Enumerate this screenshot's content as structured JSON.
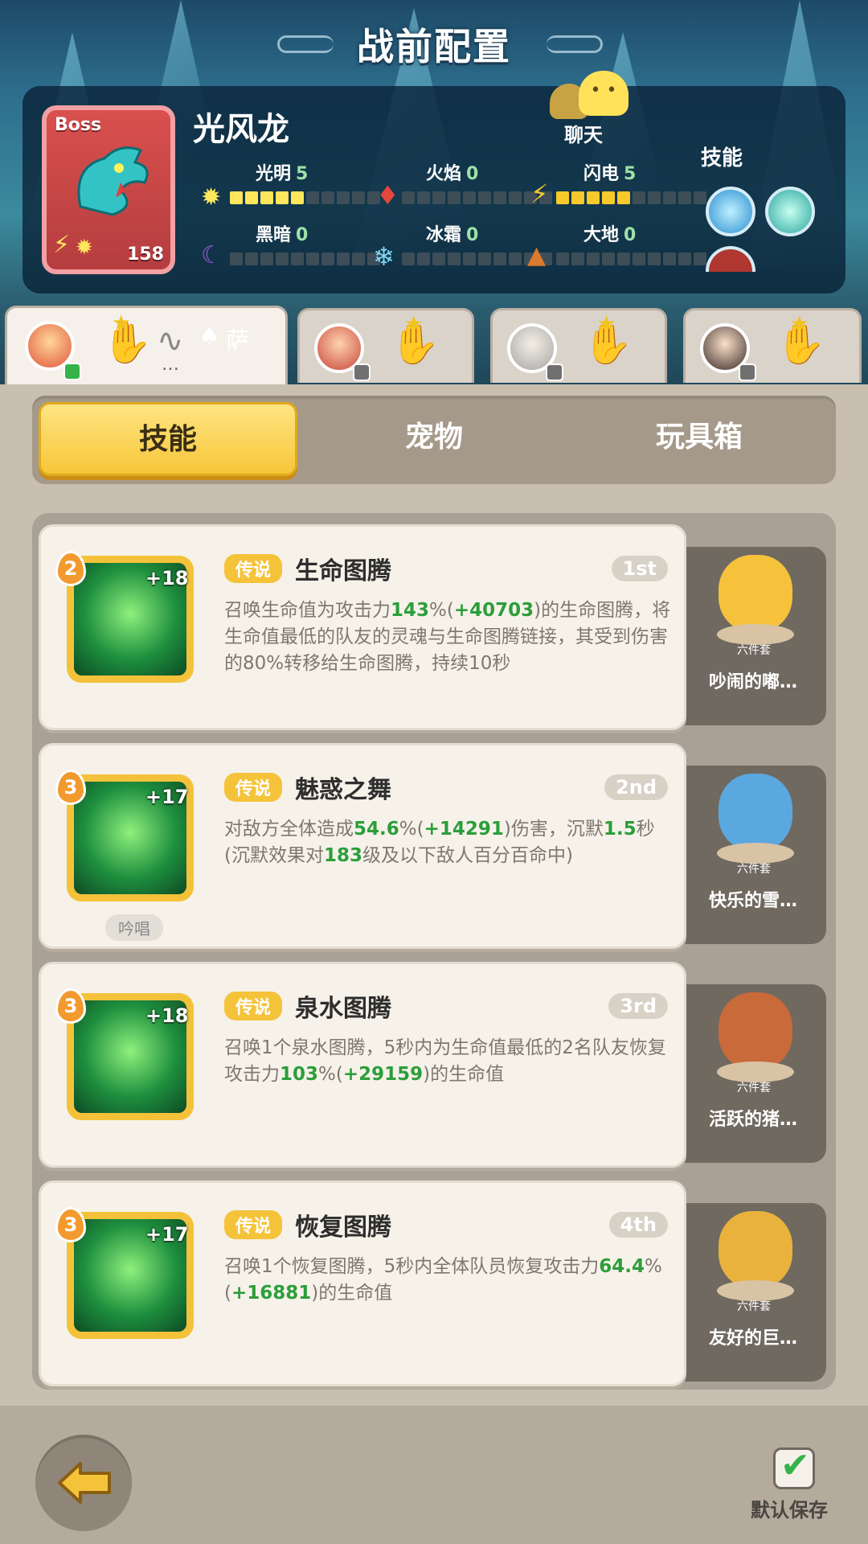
{
  "header": {
    "title": "战前配置"
  },
  "boss": {
    "tag": "Boss",
    "name": "光风龙",
    "level": "158",
    "elements": [
      {
        "label": "光明",
        "value": "5",
        "level": 5,
        "color": "#ffe65c"
      },
      {
        "label": "火焰",
        "value": "0",
        "level": 0,
        "color": "#e2483b"
      },
      {
        "label": "闪电",
        "value": "5",
        "level": 5,
        "color": "#f7c92a"
      },
      {
        "label": "黑暗",
        "value": "0",
        "level": 0,
        "color": "#9b5ad8"
      },
      {
        "label": "冰霜",
        "value": "0",
        "level": 0,
        "color": "#7fd6f2"
      },
      {
        "label": "大地",
        "value": "0",
        "level": 0,
        "color": "#d97a2c"
      }
    ],
    "chat_label": "聊天",
    "skills_label": "技能",
    "skill_icons": [
      "ice-burst-icon",
      "tornado-icon",
      "fire-icon"
    ]
  },
  "team_tabs": [
    {
      "player": "萨",
      "active": true
    },
    {
      "player": "",
      "active": false
    },
    {
      "player": "",
      "active": false
    },
    {
      "player": "",
      "active": false
    }
  ],
  "segment": {
    "tabs": [
      "技能",
      "宠物",
      "玩具箱"
    ],
    "selected": "技能"
  },
  "skills": [
    {
      "level": "2",
      "plus": "+18",
      "rarity": "传说",
      "name": "生命图腾",
      "rank": "1st",
      "desc": [
        {
          "t": "召唤生命值为攻击力"
        },
        {
          "t": "143",
          "g": true
        },
        {
          "t": "%("
        },
        {
          "t": "+40703",
          "g": true
        },
        {
          "t": ")的生命图腾，将生命值最低的队友的灵魂与生命图腾链接，其受到伤害的80%转移给生命图腾，持续10秒"
        }
      ],
      "chant": "",
      "toy": {
        "set": "六件套",
        "name": "吵闹的嘟…",
        "color": "#f6c23c"
      }
    },
    {
      "level": "3",
      "plus": "+17",
      "rarity": "传说",
      "name": "魅惑之舞",
      "rank": "2nd",
      "desc": [
        {
          "t": "对敌方全体造成"
        },
        {
          "t": "54.6",
          "g": true
        },
        {
          "t": "%("
        },
        {
          "t": "+14291",
          "g": true
        },
        {
          "t": ")伤害，沉默"
        },
        {
          "t": "1.5",
          "g": true
        },
        {
          "t": "秒(沉默效果对"
        },
        {
          "t": "183",
          "g": true
        },
        {
          "t": "级及以下敌人百分百命中)"
        }
      ],
      "chant": "吟唱",
      "toy": {
        "set": "六件套",
        "name": "快乐的雪…",
        "color": "#5ba8e0"
      }
    },
    {
      "level": "3",
      "plus": "+18",
      "rarity": "传说",
      "name": "泉水图腾",
      "rank": "3rd",
      "desc": [
        {
          "t": "召唤1个泉水图腾，5秒内为生命值最低的2名队友恢复攻击力"
        },
        {
          "t": "103",
          "g": true
        },
        {
          "t": "%("
        },
        {
          "t": "+29159",
          "g": true
        },
        {
          "t": ")的生命值"
        }
      ],
      "chant": "",
      "toy": {
        "set": "六件套",
        "name": "活跃的猪…",
        "color": "#c96a3a"
      }
    },
    {
      "level": "3",
      "plus": "+17",
      "rarity": "传说",
      "name": "恢复图腾",
      "rank": "4th",
      "desc": [
        {
          "t": "召唤1个恢复图腾，5秒内全体队员恢复攻击力"
        },
        {
          "t": "64.4",
          "g": true
        },
        {
          "t": "%("
        },
        {
          "t": "+16881",
          "g": true
        },
        {
          "t": ")的生命值"
        }
      ],
      "chant": "",
      "toy": {
        "set": "六件套",
        "name": "友好的巨…",
        "color": "#e8b23c"
      }
    }
  ],
  "footer": {
    "save_label": "默认保存"
  }
}
